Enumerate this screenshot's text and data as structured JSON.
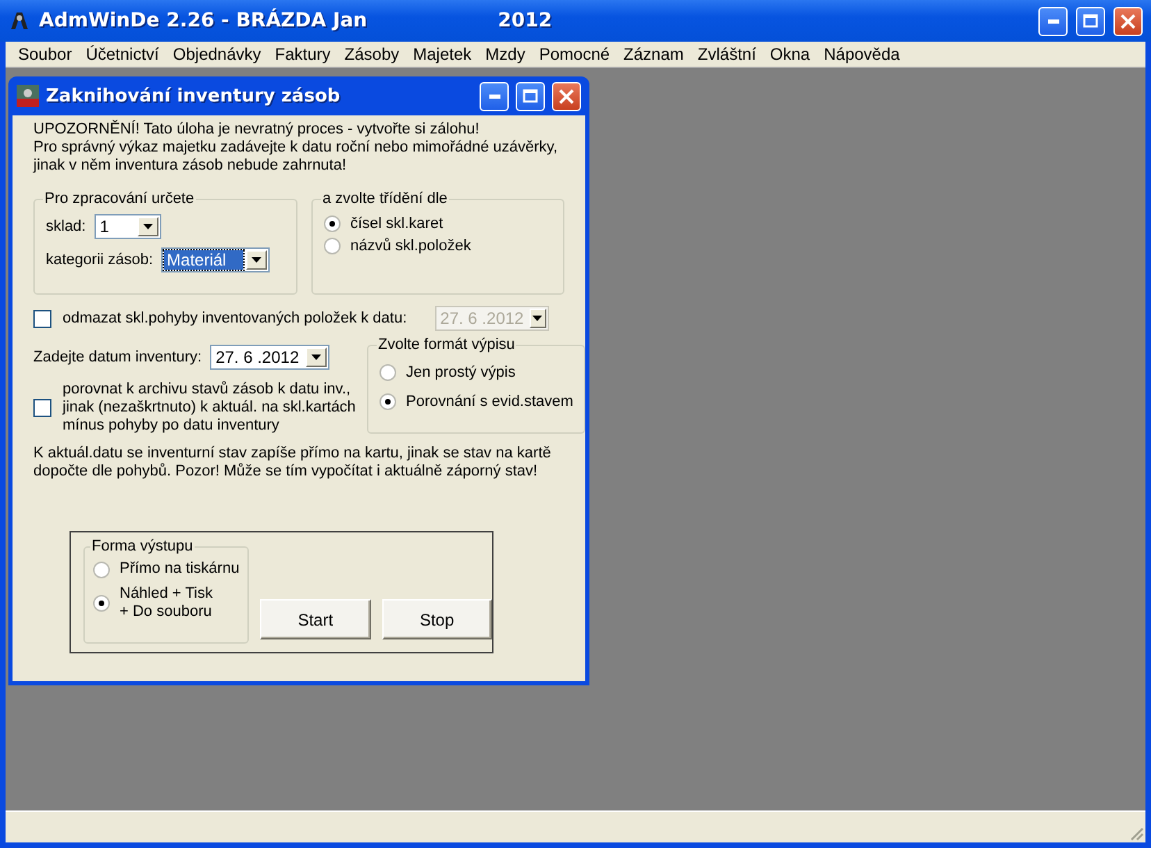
{
  "app": {
    "title": "AdmWinDe 2.26 - BRÁZDA Jan",
    "year": "2012"
  },
  "menu": [
    {
      "label": "Soubor"
    },
    {
      "label": "Účetnictví"
    },
    {
      "label": "Objednávky"
    },
    {
      "label": "Faktury"
    },
    {
      "label": "Zásoby"
    },
    {
      "label": "Majetek"
    },
    {
      "label": "Mzdy"
    },
    {
      "label": "Pomocné"
    },
    {
      "label": "Záznam"
    },
    {
      "label": "Zvláštní"
    },
    {
      "label": "Okna"
    },
    {
      "label": "Nápověda"
    }
  ],
  "dialog": {
    "title": "Zaknihování inventury zásob",
    "warning": [
      "UPOZORNĚNÍ! Tato úloha je nevratný proces - vytvořte si zálohu!",
      "Pro správný výkaz majetku zadávejte k datu roční nebo mimořádné uzávěrky,",
      "jinak v něm inventura zásob nebude zahrnuta!"
    ],
    "processing": {
      "legend": "Pro zpracování určete",
      "sklad_label": "sklad:",
      "sklad_value": "1",
      "category_label": "kategorii zásob:",
      "category_value": "Materiál",
      "category_focused": true
    },
    "sorting": {
      "legend": "a zvolte třídění dle",
      "options": [
        {
          "label": "čísel skl.karet",
          "selected": true
        },
        {
          "label": "názvů skl.položek",
          "selected": false
        }
      ]
    },
    "erase_moves": {
      "label": "odmazat skl.pohyby inventovaných položek k datu:",
      "checked": false,
      "date": "27. 6 .2012",
      "date_disabled": true
    },
    "inventory_date": {
      "label": "Zadejte datum inventury:",
      "value": "27. 6 .2012"
    },
    "compare_archive": {
      "lines": [
        "porovnat k archivu stavů zásob k datu inv.,",
        "jinak (nezaškrtnuto) k aktuál. na skl.kartách",
        "mínus pohyby po datu inventury"
      ],
      "checked": false
    },
    "format": {
      "legend": "Zvolte formát výpisu",
      "options": [
        {
          "label": "Jen prostý výpis",
          "selected": false
        },
        {
          "label": "Porovnání s evid.stavem",
          "selected": true
        }
      ]
    },
    "note": [
      "K aktuál.datu se inventurní stav zapíše přímo na kartu, jinak se stav na kartě",
      "dopočte dle pohybů. Pozor! Může se tím vypočítat i aktuálně záporný stav!"
    ],
    "output": {
      "legend": "Forma výstupu",
      "options": [
        {
          "lines": [
            "Přímo na tiskárnu"
          ],
          "selected": false
        },
        {
          "lines": [
            "Náhled + Tisk",
            "+ Do souboru"
          ],
          "selected": true
        }
      ]
    },
    "buttons": [
      {
        "label": "Start"
      },
      {
        "label": "Stop"
      }
    ]
  }
}
